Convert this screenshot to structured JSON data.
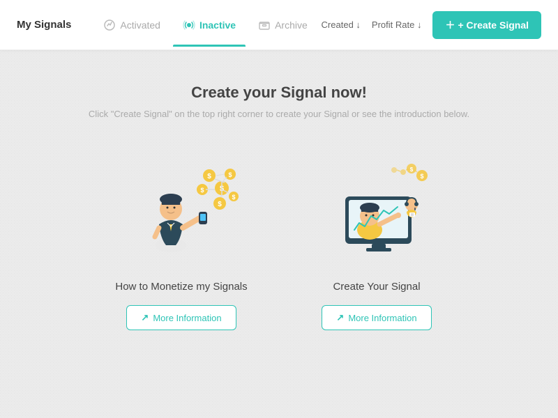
{
  "header": {
    "title": "My Signals",
    "tabs": [
      {
        "id": "activated",
        "label": "Activated",
        "active": false,
        "icon": "chart-icon"
      },
      {
        "id": "inactive",
        "label": "Inactive",
        "active": true,
        "icon": "signal-icon"
      },
      {
        "id": "archive",
        "label": "Archive",
        "active": false,
        "icon": "archive-icon"
      }
    ],
    "sort_created": "Created ↓",
    "sort_profit": "Profit Rate ↓",
    "create_btn": "+ Create Signal"
  },
  "main": {
    "heading": "Create your Signal now!",
    "subtext": "Click \"Create Signal\" on the top right corner to create your Signal or see the introduction below.",
    "cards": [
      {
        "id": "monetize",
        "label": "How to Monetize my Signals",
        "more_info_label": "More Information"
      },
      {
        "id": "create",
        "label": "Create Your Signal",
        "more_info_label": "More Information"
      }
    ]
  }
}
